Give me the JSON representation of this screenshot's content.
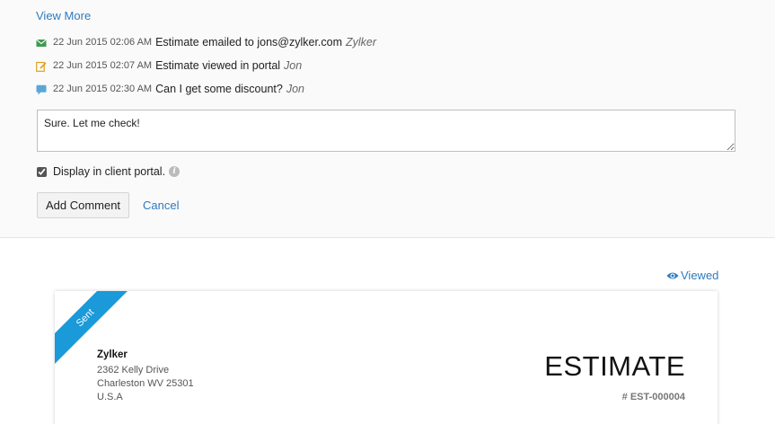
{
  "comments_panel": {
    "view_more": "View More",
    "activities": [
      {
        "icon": "envelope-icon",
        "timestamp": "22 Jun 2015 02:06 AM",
        "message": "Estimate emailed to jons@zylker.com",
        "author": "Zylker"
      },
      {
        "icon": "edit-icon",
        "timestamp": "22 Jun 2015 02:07 AM",
        "message": "Estimate viewed in portal",
        "author": "Jon"
      },
      {
        "icon": "speech-bubble-icon",
        "timestamp": "22 Jun 2015 02:30 AM",
        "message": "Can I get some discount?",
        "author": "Jon"
      }
    ],
    "comment_value": "Sure. Let me check!",
    "display_in_portal_label": "Display in client portal.",
    "display_in_portal_checked": true,
    "add_comment_label": "Add Comment",
    "cancel_label": "Cancel"
  },
  "status": {
    "viewed_label": "Viewed",
    "ribbon_label": "Sent"
  },
  "estimate": {
    "from_name": "Zylker",
    "address_lines": [
      "2362 Kelly Drive",
      "Charleston WV  25301",
      "U.S.A"
    ],
    "title": "ESTIMATE",
    "number": "# EST-000004"
  },
  "colors": {
    "link": "#2f7bbf",
    "ribbon": "#1a9ad8",
    "envelope_icon": "#3f9a52",
    "edit_icon": "#e0a21b",
    "speech_icon": "#5aa7d6"
  }
}
